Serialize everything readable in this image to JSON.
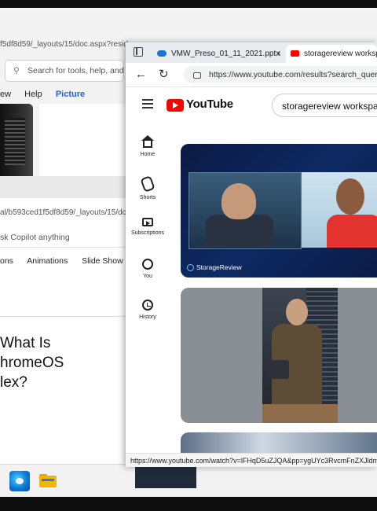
{
  "back_window_1": {
    "url_fragment": "f5df8d59/_layouts/15/doc.aspx?resid",
    "search_placeholder": "Search for tools, help, and m",
    "menu": [
      "ew",
      "Help",
      "Picture"
    ]
  },
  "back_window_2": {
    "url_fragment": "al/b593ced1f5df8d59/_layouts/15/do",
    "copilot_placeholder": "sk Copilot anything",
    "ribbon": [
      "ons",
      "Animations",
      "Slide Show"
    ],
    "slide_text": [
      "What Is",
      "hromeOS",
      "lex?"
    ]
  },
  "browser": {
    "tabs": [
      {
        "label": "VMW_Preso_01_11_2021.pptx",
        "icon": "onedrive-cloud-icon"
      },
      {
        "label": "storagereview workspace",
        "icon": "youtube-favicon"
      }
    ],
    "address": "https://www.youtube.com/results?search_query=s",
    "status_url": "https://www.youtube.com/watch?v=lFHqD5uZJQA&pp=ygUYc3RvcmFnZXJldmlldyB3"
  },
  "youtube": {
    "logo_text": "YouTube",
    "search_value": "storagereview workspace",
    "sidebar": [
      {
        "label": "Home",
        "icon": "home-icon"
      },
      {
        "label": "Shorts",
        "icon": "shorts-icon"
      },
      {
        "label": "Subscriptions",
        "icon": "subscriptions-icon"
      },
      {
        "label": "You",
        "icon": "you-icon"
      },
      {
        "label": "History",
        "icon": "history-icon"
      }
    ],
    "thumb1_brand": "StorageReview"
  },
  "colors": {
    "youtube_red": "#ff0000",
    "link_blue": "#2b62c9"
  }
}
